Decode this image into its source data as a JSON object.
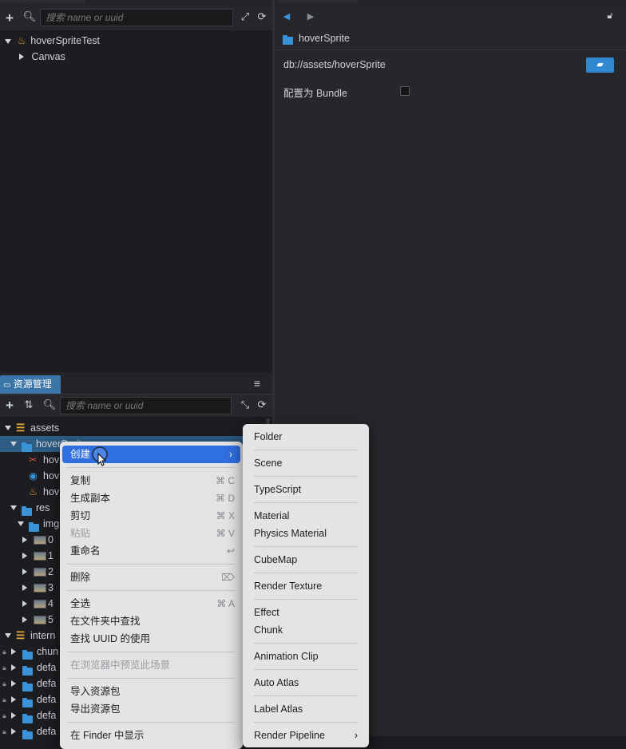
{
  "hierarchy_panel": {
    "search_placeholder": "搜索 name or uuid",
    "scene_name": "hoverSpriteTest",
    "child": "Canvas"
  },
  "inspector": {
    "selected_name": "hoverSprite",
    "path": "db://assets/hoverSprite",
    "bundle_label": "配置为 Bundle",
    "bundle_checked": false
  },
  "assets_panel": {
    "tab_label": "资源管理器",
    "menu_icon": "≡",
    "search_placeholder": "搜索 name or uuid",
    "tree": [
      {
        "label": "assets",
        "indent": 0,
        "icon": "db",
        "expand": "down"
      },
      {
        "label": "hoverSprite",
        "indent": 1,
        "icon": "folder",
        "expand": "down",
        "selected": true
      },
      {
        "label": "hov",
        "indent": 2,
        "icon": "sprite"
      },
      {
        "label": "hov",
        "indent": 2,
        "icon": "script"
      },
      {
        "label": "hov",
        "indent": 2,
        "icon": "scene"
      },
      {
        "label": "res",
        "indent": 1,
        "icon": "folder",
        "expand": "down"
      },
      {
        "label": "img",
        "indent": 2,
        "icon": "folder",
        "expand": "down"
      },
      {
        "label": "0",
        "indent": 3,
        "icon": "image",
        "expand": "right"
      },
      {
        "label": "1",
        "indent": 3,
        "icon": "image",
        "expand": "right"
      },
      {
        "label": "2",
        "indent": 3,
        "icon": "image",
        "expand": "right"
      },
      {
        "label": "3",
        "indent": 3,
        "icon": "image",
        "expand": "right"
      },
      {
        "label": "4",
        "indent": 3,
        "icon": "image",
        "expand": "right"
      },
      {
        "label": "5",
        "indent": 3,
        "icon": "image",
        "expand": "right"
      },
      {
        "label": "intern",
        "indent": 0,
        "icon": "db",
        "expand": "down"
      },
      {
        "label": "chun",
        "indent": 1,
        "icon": "folder",
        "expand": "right",
        "locked": true
      },
      {
        "label": "defa",
        "indent": 1,
        "icon": "folder",
        "expand": "right",
        "locked": true
      },
      {
        "label": "defa",
        "indent": 1,
        "icon": "folder",
        "expand": "right",
        "locked": true
      },
      {
        "label": "defa",
        "indent": 1,
        "icon": "folder",
        "expand": "right",
        "locked": true
      },
      {
        "label": "defa",
        "indent": 1,
        "icon": "folder",
        "expand": "right",
        "locked": true
      },
      {
        "label": "defa",
        "indent": 1,
        "icon": "folder",
        "expand": "right",
        "locked": true
      }
    ]
  },
  "context_menu": {
    "create": "创建",
    "copy": "复制",
    "copy_sc": "⌘ C",
    "duplicate": "生成副本",
    "duplicate_sc": "⌘ D",
    "cut": "剪切",
    "cut_sc": "⌘ X",
    "paste": "粘贴",
    "paste_sc": "⌘ V",
    "rename": "重命名",
    "rename_sc": "↩",
    "delete": "删除",
    "delete_sc": "⌦",
    "select_all": "全选",
    "select_all_sc": "⌘ A",
    "find_in_folder": "在文件夹中查找",
    "find_uuid": "查找 UUID 的使用",
    "preview_scene": "在浏览器中预览此场景",
    "import_package": "导入资源包",
    "export_package": "导出资源包",
    "show_in_finder": "在 Finder 中显示"
  },
  "submenu": {
    "folder": "Folder",
    "scene": "Scene",
    "typescript": "TypeScript",
    "material": "Material",
    "physics_material": "Physics Material",
    "cubemap": "CubeMap",
    "render_texture": "Render Texture",
    "effect": "Effect",
    "chunk": "Chunk",
    "animation_clip": "Animation Clip",
    "auto_atlas": "Auto Atlas",
    "label_atlas": "Label Atlas",
    "render_pipeline": "Render Pipeline"
  },
  "colors": {
    "accent": "#2f6fe0",
    "selection_row": "#2d5d86",
    "folder": "#3a93d8"
  }
}
